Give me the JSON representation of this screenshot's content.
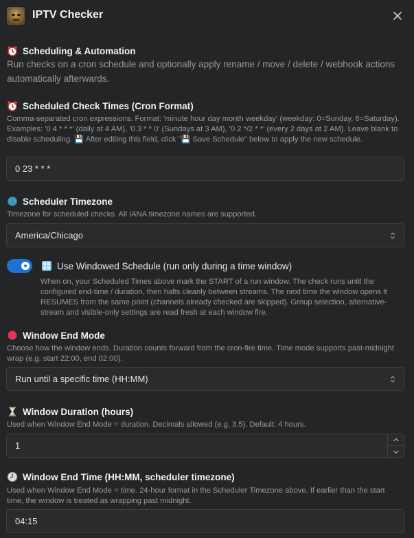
{
  "app": {
    "title": "IPTV Checker"
  },
  "intro": {
    "title": "Scheduling & Automation",
    "description": "Run checks on a cron schedule and optionally apply rename / move / delete / webhook actions automatically afterwards."
  },
  "cron": {
    "label": "Scheduled Check Times (Cron Format)",
    "help": "Comma-separated cron expressions. Format: 'minute hour day month weekday' (weekday: 0=Sunday, 6=Saturday). Examples: '0 4 * * *' (daily at 4 AM), '0 3 * * 0' (Sundays at 3 AM), '0 2 */2 * *' (every 2 days at 2 AM). Leave blank to disable scheduling. 💾 After editing this field, click \"💾 Save Schedule\" below to apply the new schedule.",
    "value": "0 23 * * *"
  },
  "timezone": {
    "label": "Scheduler Timezone",
    "help": "Timezone for scheduled checks. All IANA timezone names are supported.",
    "value": "America/Chicago"
  },
  "windowed": {
    "label": "Use Windowed Schedule (run only during a time window)",
    "enabled": true,
    "help": "When on, your Scheduled Times above mark the START of a run window. The check runs until the configured end-time / duration, then halts cleanly between streams. The next time the window opens it RESUMES from the same point (channels already checked are skipped). Group selection, alternative-stream and visible-only settings are read fresh at each window fire."
  },
  "end_mode": {
    "label": "Window End Mode",
    "help": "Choose how the window ends. Duration counts forward from the cron-fire time. Time mode supports past-midnight wrap (e.g. start 22:00, end 02:00).",
    "value": "Run until a specific time (HH:MM)"
  },
  "duration": {
    "label": "Window Duration (hours)",
    "help": "Used when Window End Mode = duration. Decimals allowed (e.g. 3.5). Default: 4 hours.",
    "value": "1"
  },
  "end_time": {
    "label": "Window End Time (HH:MM, scheduler timezone)",
    "help": "Used when Window End Mode = time. 24-hour format in the Scheduler Timezone above. If earlier than the start time, the window is treated as wrapping past midnight.",
    "value": "04:15"
  },
  "colors": {
    "background": "#242526",
    "field": "#2a2b2d",
    "accent": "#1f73d0",
    "muted_text": "#9a9a9a"
  },
  "icons": {
    "intro": "alarm-clock-icon",
    "cron": "alarm-clock-icon",
    "timezone": "globe-icon",
    "windowed": "window-icon",
    "end_mode": "red-circle-icon",
    "duration": "hourglass-icon",
    "end_time": "clock-icon"
  }
}
